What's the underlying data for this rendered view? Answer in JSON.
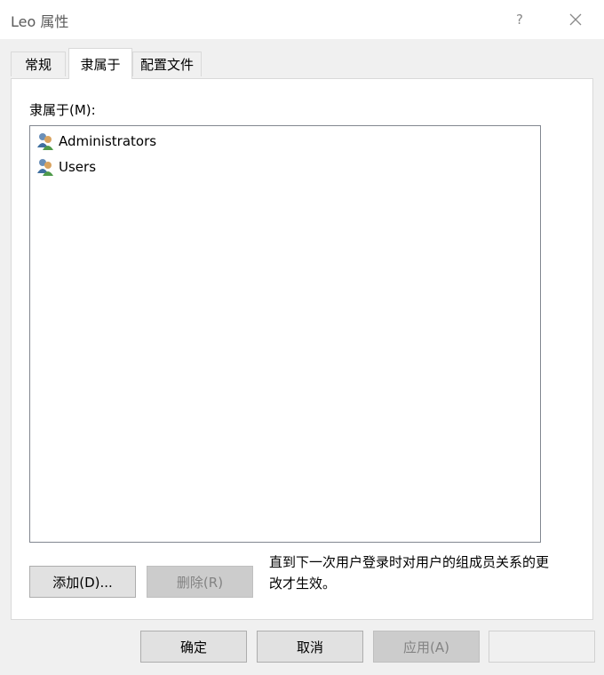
{
  "window": {
    "title": "Leo 属性",
    "help_glyph": "?",
    "close_glyph": "✕"
  },
  "tabs": [
    {
      "label": "常规",
      "active": false
    },
    {
      "label": "隶属于",
      "active": true
    },
    {
      "label": "配置文件",
      "active": false
    }
  ],
  "member_of": {
    "label": "隶属于(M):",
    "items": [
      {
        "name": "Administrators",
        "icon": "user-group-icon"
      },
      {
        "name": "Users",
        "icon": "user-group-icon"
      }
    ]
  },
  "actions": {
    "add_label": "添加(D)...",
    "remove_label": "删除(R)",
    "note": "直到下一次用户登录时对用户的组成员关系的更改才生效。"
  },
  "footer": {
    "ok_label": "确定",
    "cancel_label": "取消",
    "apply_label": "应用(A)"
  }
}
